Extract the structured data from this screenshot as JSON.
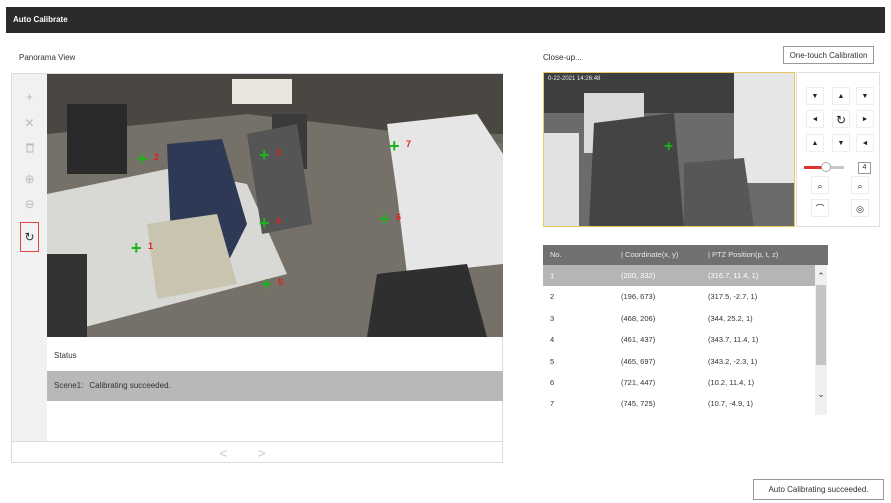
{
  "header": {
    "title": "Auto Calibrate"
  },
  "panorama": {
    "label": "Panorama View",
    "points": [
      {
        "label": "1"
      },
      {
        "label": "2"
      },
      {
        "label": "3"
      },
      {
        "label": "4"
      },
      {
        "label": "5"
      },
      {
        "label": "6"
      },
      {
        "label": "7"
      }
    ],
    "status_title": "Status",
    "status_scene": "Scene1:",
    "status_message": "Calibrating succeeded.",
    "pager_prev": "<",
    "pager_next": ">"
  },
  "closeup": {
    "label": "Close-up...",
    "osd_text": "0-22-2021 14:26:48"
  },
  "one_touch_label": "One-touch Calibration",
  "ptz": {
    "speed": "4"
  },
  "table": {
    "headers": [
      "No.",
      "| Coordinate(x, y)",
      "| PTZ Position(p, t, z)"
    ],
    "rows": [
      {
        "no": "1",
        "coord": "(200, 332)",
        "ptz": "(316.7, 11.4, 1)"
      },
      {
        "no": "2",
        "coord": "(196, 673)",
        "ptz": "(317.5, -2.7, 1)"
      },
      {
        "no": "3",
        "coord": "(468, 206)",
        "ptz": "(344, 25.2, 1)"
      },
      {
        "no": "4",
        "coord": "(461, 437)",
        "ptz": "(343.7, 11.4, 1)"
      },
      {
        "no": "5",
        "coord": "(465, 697)",
        "ptz": "(343.2, -2.3, 1)"
      },
      {
        "no": "6",
        "coord": "(721, 447)",
        "ptz": "(10.2, 11.4, 1)"
      },
      {
        "no": "7",
        "coord": "(745, 725)",
        "ptz": "(10.7, -4.9, 1)"
      }
    ]
  },
  "toast": "Auto Calibrating succeeded.",
  "colors": {
    "marker": "#1db31d",
    "marker_label": "#e02020",
    "selected_row": "#b5b5b5",
    "header_bar": "#2b2b2b"
  }
}
